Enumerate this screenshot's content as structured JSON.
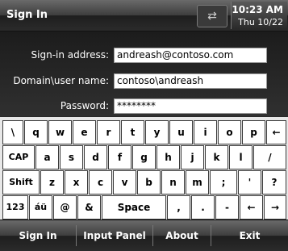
{
  "titlebar": {
    "title": "Sign In",
    "connectivity_icon": "connectivity-icon",
    "time": "10:23 AM",
    "date": "Thu 10/22"
  },
  "form": {
    "signin_label": "Sign-in address:",
    "signin_value": "andreash@contoso.com",
    "domain_label": "Domain\\user name:",
    "domain_value": "contoso\\andreash",
    "password_label": "Password:",
    "password_value": "********"
  },
  "keyboard": {
    "row1": [
      "\\",
      "q",
      "w",
      "e",
      "r",
      "t",
      "y",
      "u",
      "i",
      "o",
      "p",
      "←"
    ],
    "row2": [
      "CAP",
      "a",
      "s",
      "d",
      "f",
      "g",
      "h",
      "j",
      "k",
      "l",
      "/"
    ],
    "row3": [
      "Shift",
      "z",
      "x",
      "c",
      "v",
      "b",
      "n",
      "m",
      ";",
      "'",
      "?"
    ],
    "row4": [
      "123",
      "áü",
      "@",
      "&",
      "Space",
      ",",
      ".",
      "-",
      "←",
      "→"
    ]
  },
  "menubar": {
    "items": [
      "Sign In",
      "Input Panel",
      "About",
      "Exit"
    ]
  }
}
